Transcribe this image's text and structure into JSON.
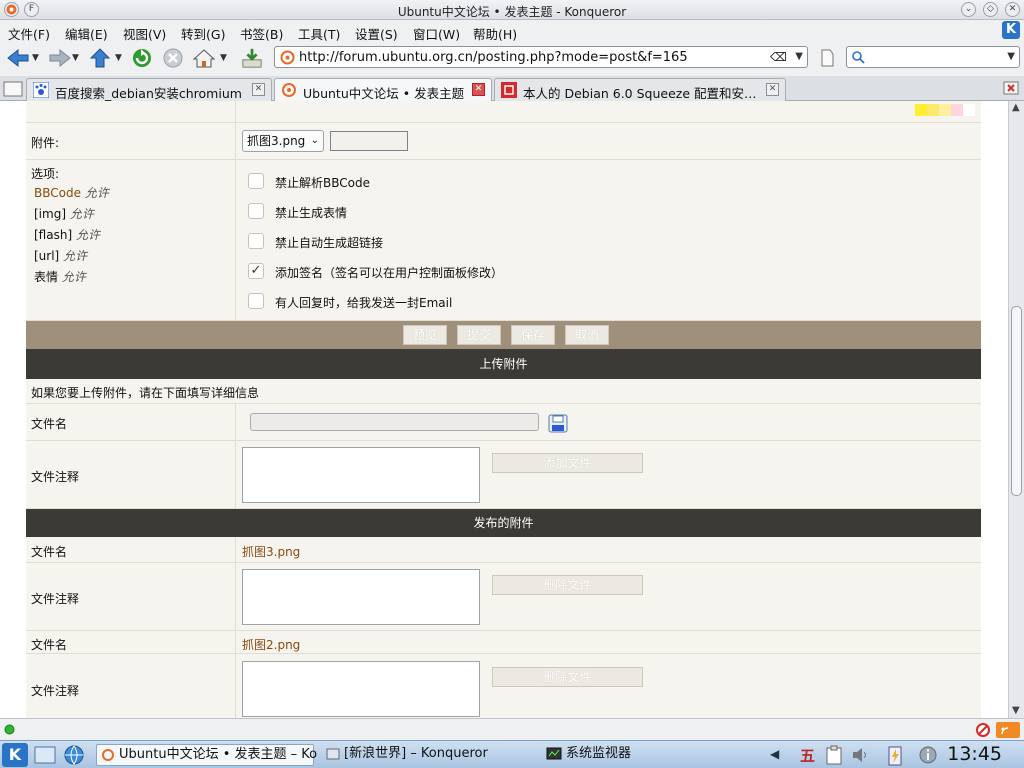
{
  "window": {
    "title": "Ubuntu中文论坛 • 发表主题 - Konqueror"
  },
  "menu": {
    "items": [
      "文件(F)",
      "编辑(E)",
      "视图(V)",
      "转到(G)",
      "书签(B)",
      "工具(T)",
      "设置(S)",
      "窗口(W)",
      "帮助(H)"
    ]
  },
  "toolbar": {
    "url": "http://forum.ubuntu.org.cn/posting.php?mode=post&f=165",
    "search_value": ""
  },
  "tabs": [
    {
      "label": "百度搜索_debian安装chromium",
      "active": false
    },
    {
      "label": "Ubuntu中文论坛 • 发表主题",
      "active": true
    },
    {
      "label": "本人的 Debian 6.0 Squeeze 配置和安…",
      "active": false
    }
  ],
  "form": {
    "attachment_label": "附件:",
    "attachment_select": "抓图3.png",
    "options_label": "选项:",
    "options_allow": [
      {
        "name": "BBCode",
        "state": "允许",
        "link": true
      },
      {
        "name": "[img]",
        "state": "允许",
        "link": false
      },
      {
        "name": "[flash]",
        "state": "允许",
        "link": false
      },
      {
        "name": "[url]",
        "state": "允许",
        "link": false
      },
      {
        "name": "表情",
        "state": "允许",
        "link": false
      }
    ],
    "checkboxes": [
      {
        "label": "禁止解析BBCode",
        "checked": false
      },
      {
        "label": "禁止生成表情",
        "checked": false
      },
      {
        "label": "禁止自动生成超链接",
        "checked": false
      },
      {
        "label": "添加签名（签名可以在用户控制面板修改）",
        "checked": true
      },
      {
        "label": "有人回复时，给我发送一封Email",
        "checked": false
      }
    ],
    "buttons": {
      "preview": "预览",
      "submit": "提交",
      "save": "保存",
      "cancel": "取消"
    }
  },
  "upload": {
    "header": "上传附件",
    "hint": "如果您要上传附件，请在下面填写详细信息",
    "filename_label": "文件名",
    "comment_label": "文件注释",
    "add_button": "添加文件"
  },
  "posted": {
    "header": "发布的附件",
    "items": [
      {
        "filename_label": "文件名",
        "filename": "抓图3.png",
        "comment_label": "文件注释",
        "delete_button": "删除文件"
      },
      {
        "filename_label": "文件名",
        "filename": "抓图2.png",
        "comment_label": "文件注释",
        "delete_button": "删除文件"
      }
    ]
  },
  "taskbar": {
    "items": [
      {
        "label": "Ubuntu中文论坛 • 发表主题 – Ko",
        "active": true
      },
      {
        "label": "[新浪世界] – Konqueror",
        "active": false
      },
      {
        "label": "系统监视器",
        "active": false
      }
    ],
    "ime": "五",
    "clock": "13:45"
  },
  "colors": {
    "accent_link": "#8a4a10",
    "bar_tan": "#9f907b",
    "bar_dark": "#3b3a35",
    "page_bg": "#f6f4ef"
  }
}
